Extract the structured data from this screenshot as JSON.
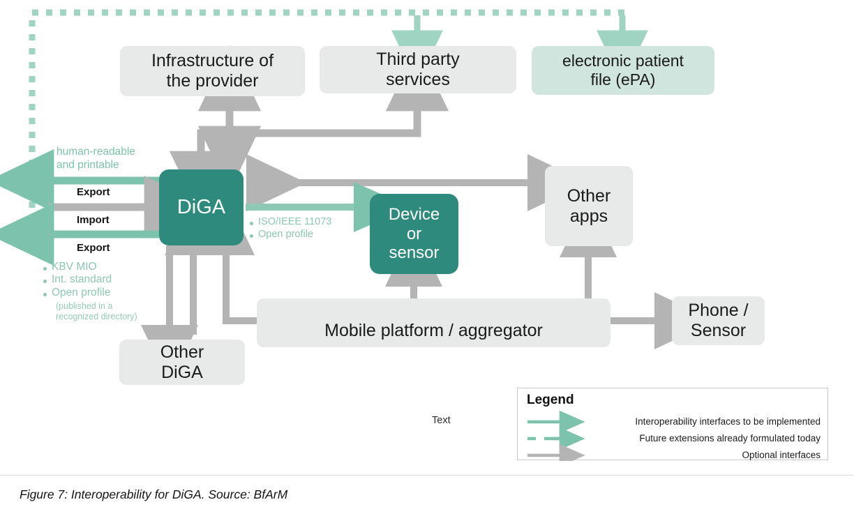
{
  "figure": {
    "caption": "Figure 7: Interoperability for DiGA. Source: BfArM",
    "stray_text": "Text"
  },
  "colors": {
    "teal_solid": "#2e8a7c",
    "teal_arrow": "#7cc2ad",
    "teal_tint_box": "#cfe5de",
    "gray_box": "#e8eae9",
    "gray_arrow": "#b4b4b4",
    "teal_text": "#7cc2ad"
  },
  "nodes": {
    "infrastructure": {
      "label": "Infrastructure of\nthe provider",
      "style": "gray"
    },
    "third_party": {
      "label": "Third party\nservices",
      "style": "gray"
    },
    "epa": {
      "label": "electronic patient\nfile (ePA)",
      "style": "teal-tint"
    },
    "diga": {
      "label": "DiGA",
      "style": "teal"
    },
    "device": {
      "label": "Device\nor\nsensor",
      "style": "teal"
    },
    "other_apps": {
      "label": "Other\napps",
      "style": "gray"
    },
    "other_diga": {
      "label": "Other\nDiGA",
      "style": "gray"
    },
    "mobile_platform": {
      "label": "Mobile platform / aggregator",
      "style": "gray"
    },
    "phone_sensor": {
      "label": "Phone /\nSensor",
      "style": "gray"
    }
  },
  "annotations": {
    "human_readable": "human-readable\nand printable",
    "export_top": "Export",
    "import": "Import",
    "export_bottom": "Export",
    "left_bullets": [
      "KBV MIO",
      "Int. standard",
      "Open profile"
    ],
    "left_bullets_note": "(published in a\nrecognized directory)",
    "device_bullets": [
      "ISO/IEEE 11073",
      "Open profile"
    ]
  },
  "legend": {
    "title": "Legend",
    "items": [
      {
        "style": "solid-teal",
        "label": "Interoperability interfaces to be implemented"
      },
      {
        "style": "dashed-teal",
        "label": "Future extensions already formulated today"
      },
      {
        "style": "solid-gray",
        "label": "Optional interfaces"
      }
    ]
  }
}
